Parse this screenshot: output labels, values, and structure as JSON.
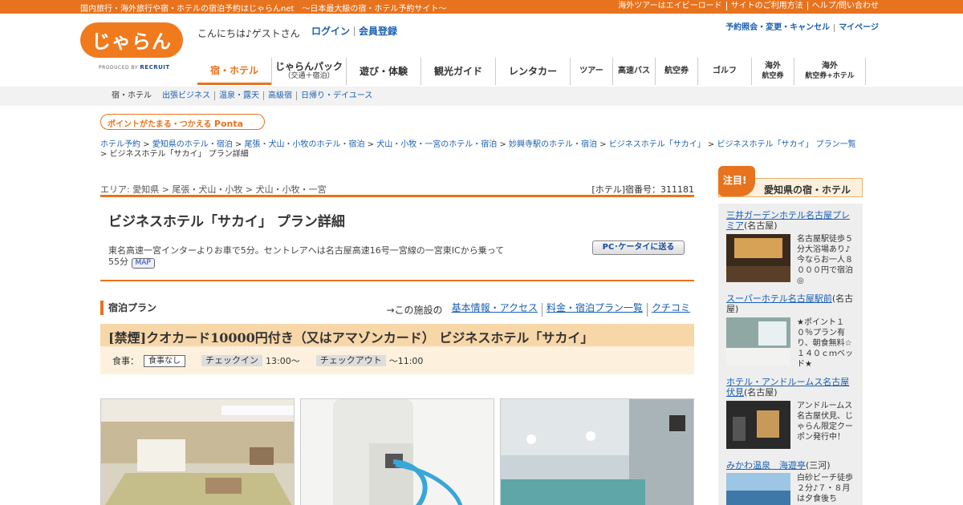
{
  "topbar": {
    "tagline": "国内旅行・海外旅行や宿・ホテルの宿泊予約はじゃらんnet　～日本最大級の宿・ホテル予約サイト～",
    "links": [
      "海外ツアーはエイビーロード",
      "サイトのご利用方法",
      "ヘルプ/問い合わせ"
    ]
  },
  "header": {
    "logo_text": "じゃらん",
    "produced_by": "PRODUCED BY",
    "recruit": "RECRUIT",
    "greeting": "こんにちは♪ゲストさん",
    "login": "ログイン",
    "register": "会員登録",
    "links": [
      "予約照会・変更・キャンセル",
      "マイページ"
    ]
  },
  "nav": {
    "items": [
      {
        "label": "宿・ホテル"
      },
      {
        "label": "じゃらんパック",
        "sub": "（交通＋宿泊）"
      },
      {
        "label": "遊び・体験"
      },
      {
        "label": "観光ガイド"
      },
      {
        "label": "レンタカー"
      },
      {
        "label": "ツアー"
      },
      {
        "label": "高速バス"
      },
      {
        "label": "航空券"
      },
      {
        "label": "ゴルフ"
      },
      {
        "label": "海外",
        "sub": "航空券"
      },
      {
        "label": "海外",
        "sub": "航空券+ホテル"
      }
    ]
  },
  "subnav": {
    "items": [
      "宿・ホテル",
      "出張ビジネス",
      "温泉・露天",
      "高級宿",
      "日帰り・デイユース"
    ]
  },
  "ponta": {
    "text": "ポイントがたまる・つかえる",
    "brand": "Ponta"
  },
  "breadcrumb": {
    "links": [
      "ホテル予約",
      "愛知県のホテル・宿泊",
      "尾張・犬山・小牧のホテル・宿泊",
      "犬山・小牧・一宮のホテル・宿泊",
      "妙興寺駅のホテル・宿泊",
      "ビジネスホテル「サカイ」",
      "ビジネスホテル「サカイ」 プラン一覧"
    ],
    "current": "ビジネスホテル「サカイ」 プラン詳細"
  },
  "area": {
    "text": "エリア: 愛知県 > 尾張・犬山・小牧 > 犬山・小牧・一宮",
    "hotel_no": "[ホテル]宿番号：311181"
  },
  "hotel": {
    "title": "ビジネスホテル「サカイ」 プラン詳細",
    "access": "東名高速一宮インターよりお車で5分。セントレアへは名古屋高速16号一宮線の一宮東ICから乗って55分",
    "map": "MAP",
    "send_button": "PC･ケータイに送る"
  },
  "plan": {
    "section": "宿泊プラン",
    "links_prefix": "→この施設の",
    "links": [
      "基本情報・アクセス",
      "料金・宿泊プラン一覧",
      "クチコミ"
    ],
    "title": "[禁煙]クオカード10000円付き（又はアマゾンカード） ビジネスホテル「サカイ」",
    "meal_label": "食事：",
    "meal": "食事なし",
    "checkin_label": "チェックイン",
    "checkin": "13:00～",
    "checkout_label": "チェックアウト",
    "checkout": "～11:00"
  },
  "sidebar": {
    "badge": "注目!",
    "title": "愛知県の宿・ホテル",
    "hotels": [
      {
        "name": "三井ガーデンホテル名古屋プレミア",
        "area": "(名古屋)",
        "desc": "名古屋駅徒歩５分大浴場あり♪今ならお一人８０００円で宿泊◎"
      },
      {
        "name": "スーパーホテル名古屋駅前",
        "area": "(名古屋)",
        "desc": "★ポイント１０％プラン有り、朝食無料☆１４０ｃｍベッド★"
      },
      {
        "name": "ホテル・アンドルームス名古屋伏見",
        "area": "(名古屋)",
        "desc": "アンドルームス名古屋伏見、じゃらん限定クーポン発行中！"
      },
      {
        "name": "みかわ温泉　海遊亭",
        "area": "(三河)",
        "desc": "白砂ビーチ徒歩２分♪７・８月は夕食後ち"
      }
    ]
  }
}
